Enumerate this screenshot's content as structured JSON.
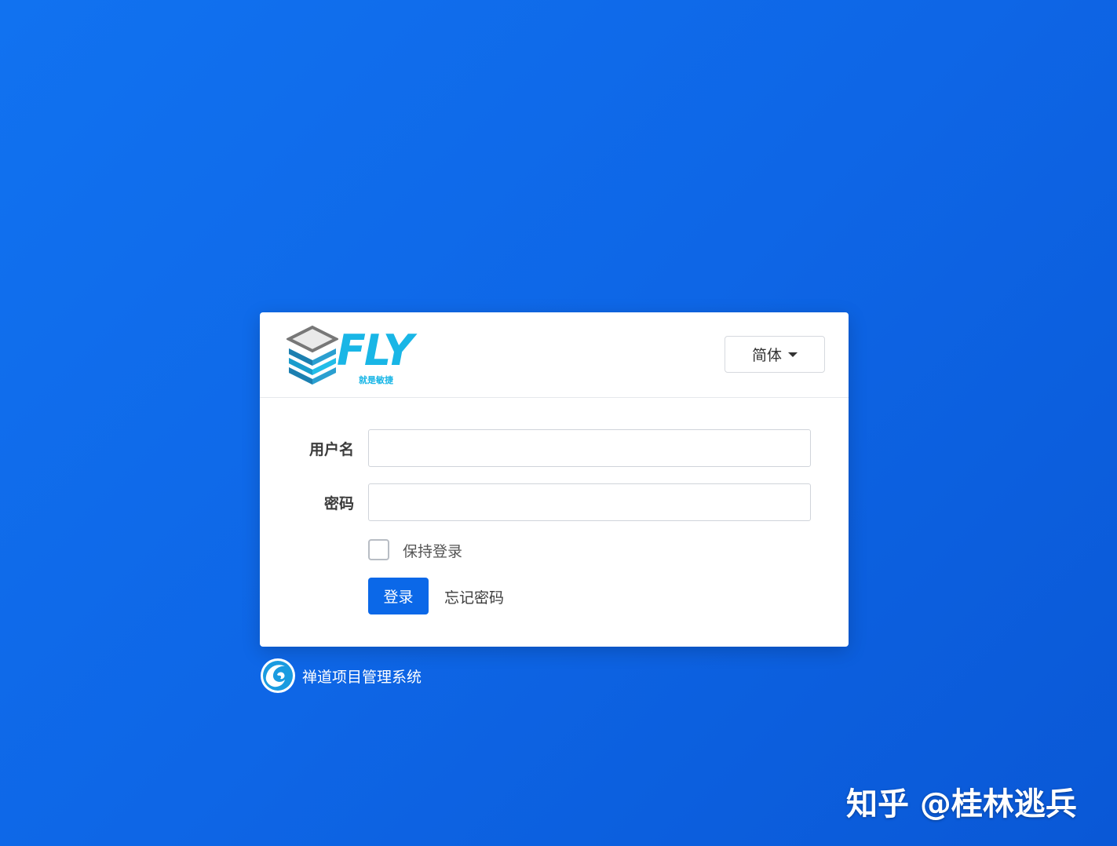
{
  "logo": {
    "text": "FLY",
    "tagline": "就是敏捷",
    "icon": "stacked-layers-logo"
  },
  "language_selector": {
    "selected": "简体",
    "icon": "caret-down-icon"
  },
  "form": {
    "username_label": "用户名",
    "username_value": "",
    "password_label": "密码",
    "password_value": "",
    "remember_label": "保持登录",
    "remember_checked": false,
    "login_button": "登录",
    "forgot_link": "忘记密码"
  },
  "footer": {
    "product_name": "禅道项目管理系统",
    "icon": "zentao-logo-icon"
  },
  "watermark": {
    "text": "知乎 @桂林逃兵"
  },
  "colors": {
    "background": "#0e66e6",
    "primary_button": "#0b68e8",
    "logo_accent": "#19b6e6"
  }
}
